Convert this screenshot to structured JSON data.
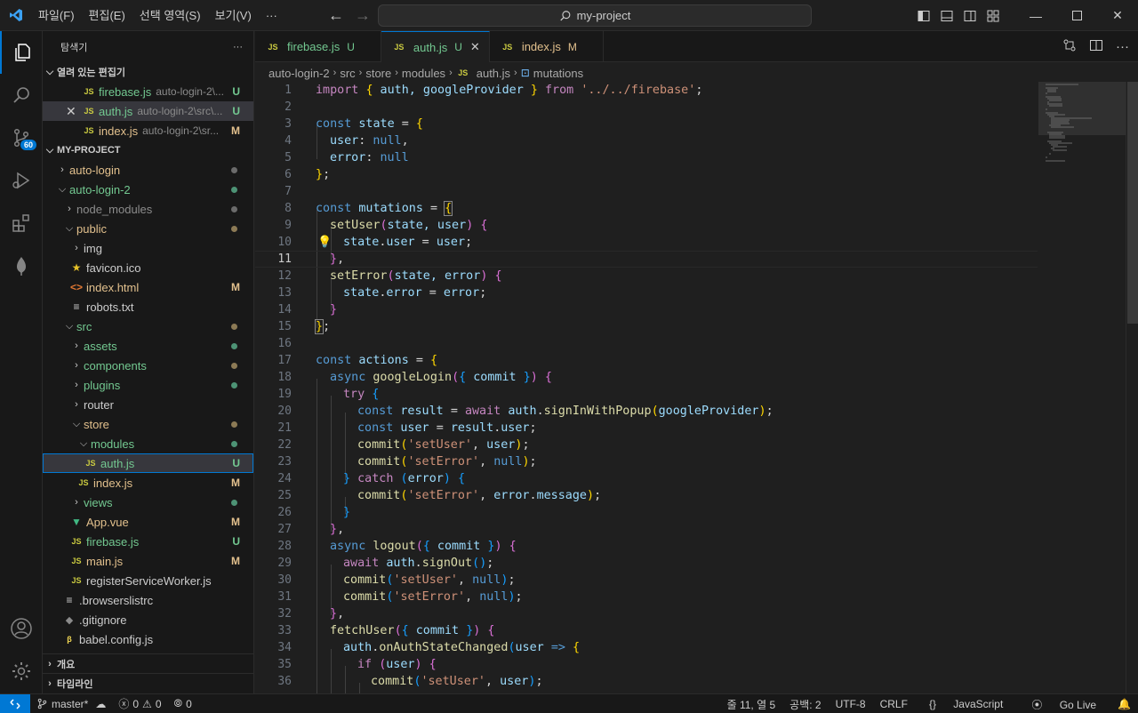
{
  "titlebar": {
    "menu": [
      "파일(F)",
      "편집(E)",
      "선택 영역(S)",
      "보기(V)",
      "···"
    ],
    "search": "my-project"
  },
  "activity": {
    "source_control_badge": "60"
  },
  "sidebar": {
    "title": "탐색기",
    "more": "···",
    "open_editors_label": "열려 있는 편집기",
    "open_editors": [
      {
        "name": "firebase.js",
        "path": "auto-login-2\\...",
        "status": "U"
      },
      {
        "name": "auth.js",
        "path": "auto-login-2\\src\\...",
        "status": "U"
      },
      {
        "name": "index.js",
        "path": "auto-login-2\\sr...",
        "status": "M"
      }
    ],
    "project_label": "MY-PROJECT",
    "tree": {
      "auto_login": "auto-login",
      "auto_login_2": "auto-login-2",
      "node_modules": "node_modules",
      "public": "public",
      "img": "img",
      "favicon": "favicon.ico",
      "index_html": "index.html",
      "index_html_status": "M",
      "robots": "robots.txt",
      "src": "src",
      "assets": "assets",
      "components": "components",
      "plugins": "plugins",
      "router": "router",
      "store": "store",
      "modules": "modules",
      "auth_js": "auth.js",
      "auth_js_status": "U",
      "index_js": "index.js",
      "index_js_status": "M",
      "views": "views",
      "app_vue": "App.vue",
      "app_vue_status": "M",
      "firebase_js": "firebase.js",
      "firebase_js_status": "U",
      "main_js": "main.js",
      "main_js_status": "M",
      "rsw": "registerServiceWorker.js",
      "browserslistrc": ".browserslistrc",
      "gitignore": ".gitignore",
      "babel": "babel.config.js"
    },
    "outline_label": "개요",
    "timeline_label": "타임라인"
  },
  "tabs": [
    {
      "name": "firebase.js",
      "status": "U"
    },
    {
      "name": "auth.js",
      "status": "U"
    },
    {
      "name": "index.js",
      "status": "M"
    }
  ],
  "breadcrumb": [
    "auto-login-2",
    "src",
    "store",
    "modules",
    "auth.js",
    "mutations"
  ],
  "code": {
    "line_numbers": [
      "1",
      "2",
      "3",
      "4",
      "5",
      "6",
      "7",
      "8",
      "9",
      "10",
      "11",
      "12",
      "13",
      "14",
      "15",
      "16",
      "17",
      "18",
      "19",
      "20",
      "21",
      "22",
      "23",
      "24",
      "25",
      "26",
      "27",
      "28",
      "29",
      "30",
      "31",
      "32",
      "33",
      "34",
      "35",
      "36"
    ],
    "l1": [
      "import",
      " ",
      "{",
      " auth, googleProvider ",
      "}",
      " ",
      "from",
      " ",
      "'../../firebase'",
      ";"
    ],
    "l3": [
      "const",
      " state ",
      "=",
      " ",
      "{"
    ],
    "l4": [
      "user",
      ": ",
      "null",
      ","
    ],
    "l5": [
      "error",
      ": ",
      "null"
    ],
    "l6": [
      "}",
      ";"
    ],
    "l8": [
      "const",
      " mutations ",
      "=",
      " ",
      "{"
    ],
    "l9": [
      "setUser",
      "(",
      "state, user",
      ")",
      " ",
      "{"
    ],
    "l10": [
      "state",
      ".",
      "user",
      " = ",
      "user",
      ";"
    ],
    "l11": [
      "}",
      ","
    ],
    "l12": [
      "setError",
      "(",
      "state, error",
      ")",
      " ",
      "{"
    ],
    "l13": [
      "state",
      ".",
      "error",
      " = ",
      "error",
      ";"
    ],
    "l14": [
      "}"
    ],
    "l15": [
      "}",
      ";"
    ],
    "l17": [
      "const",
      " actions ",
      "=",
      " ",
      "{"
    ],
    "l18": [
      "async",
      " ",
      "googleLogin",
      "(",
      "{",
      " commit ",
      "}",
      ")",
      " ",
      "{"
    ],
    "l19": [
      "try",
      " ",
      "{"
    ],
    "l20": [
      "const",
      " result ",
      "=",
      " ",
      "await",
      " ",
      "auth",
      ".",
      "signInWithPopup",
      "(",
      "googleProvider",
      ")",
      ";"
    ],
    "l21": [
      "const",
      " user ",
      "=",
      " ",
      "result",
      ".",
      "user",
      ";"
    ],
    "l22": [
      "commit",
      "(",
      "'setUser'",
      ", ",
      "user",
      ")",
      ";"
    ],
    "l23": [
      "commit",
      "(",
      "'setError'",
      ", ",
      "null",
      ")",
      ";"
    ],
    "l24": [
      "}",
      " ",
      "catch",
      " ",
      "(",
      "error",
      ")",
      " ",
      "{"
    ],
    "l25": [
      "commit",
      "(",
      "'setError'",
      ", ",
      "error",
      ".",
      "message",
      ")",
      ";"
    ],
    "l26": [
      "}"
    ],
    "l27": [
      "}",
      ","
    ],
    "l28": [
      "async",
      " ",
      "logout",
      "(",
      "{",
      " commit ",
      "}",
      ")",
      " ",
      "{"
    ],
    "l29": [
      "await",
      " ",
      "auth",
      ".",
      "signOut",
      "(",
      ")",
      ";"
    ],
    "l30": [
      "commit",
      "(",
      "'setUser'",
      ", ",
      "null",
      ")",
      ";"
    ],
    "l31": [
      "commit",
      "(",
      "'setError'",
      ", ",
      "null",
      ")",
      ";"
    ],
    "l32": [
      "}",
      ","
    ],
    "l33": [
      "fetchUser",
      "(",
      "{",
      " commit ",
      "}",
      ")",
      " ",
      "{"
    ],
    "l34": [
      "auth",
      ".",
      "onAuthStateChanged",
      "(",
      "user",
      " ",
      "=>",
      " ",
      "{"
    ],
    "l35": [
      "if",
      " ",
      "(",
      "user",
      ")",
      " ",
      "{"
    ],
    "l36": [
      "commit",
      "(",
      "'setUser'",
      ", ",
      "user",
      ")",
      ";"
    ]
  },
  "status": {
    "branch": "master*",
    "errors": "0",
    "warnings": "0",
    "ports": "0",
    "position": "줄 11, 열 5",
    "spaces": "공백: 2",
    "encoding": "UTF-8",
    "eol": "CRLF",
    "language": "JavaScript",
    "golive": "Go Live"
  }
}
